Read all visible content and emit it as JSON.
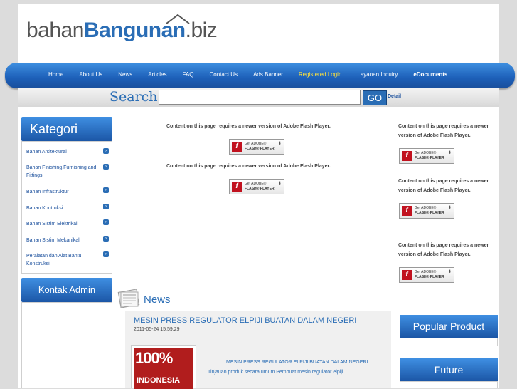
{
  "logo": {
    "part1": "bahan",
    "part2": "Bangunan",
    "part3": ".biz"
  },
  "nav": {
    "items": [
      "Home",
      "About Us",
      "News",
      "Articles",
      "FAQ",
      "Contact Us",
      "Ads Banner",
      "Registered Login",
      "Layanan Inquiry",
      "eDocuments"
    ]
  },
  "search": {
    "label": "Search",
    "go": "GO",
    "detail": "Detail",
    "value": ""
  },
  "kategori": {
    "title": "Kategori",
    "items": [
      "Bahan Arsitektural",
      "Bahan Finishing,Furnishing and Fittings",
      "Bahan Infrastruktur",
      "Bahan Kontruksi",
      "Bahan Sistim Elektrikal",
      "Bahan Sistim Mekanikal",
      "Peralatan dan Alat Bantu Konstruksi"
    ]
  },
  "kontak": {
    "title": "Kontak Admin"
  },
  "flash": {
    "message": "Content on this page requires a newer version of Adobe Flash Player.",
    "button_line1": "Get ADOBE®",
    "button_line2": "FLASH® PLAYER"
  },
  "news": {
    "title": "News",
    "article": {
      "title": "MESIN PRESS REGULATOR ELPIJI BUATAN DALAM NEGERI",
      "date": "2011-05-24 15:59:29",
      "thumb_text1": "100%",
      "thumb_text2": "INDONESIA",
      "heading": "MESIN PRESS REGULATOR ELPIJI BUATAN DALAM NEGERI",
      "excerpt": "Tinjauan produk secara umum Pembuat mesin regulator elpiji..."
    }
  },
  "right": {
    "popular": "Popular Product",
    "future": "Future"
  },
  "colors": {
    "brand": "#2a6db5",
    "nav_highlight": "#ffe23a"
  }
}
